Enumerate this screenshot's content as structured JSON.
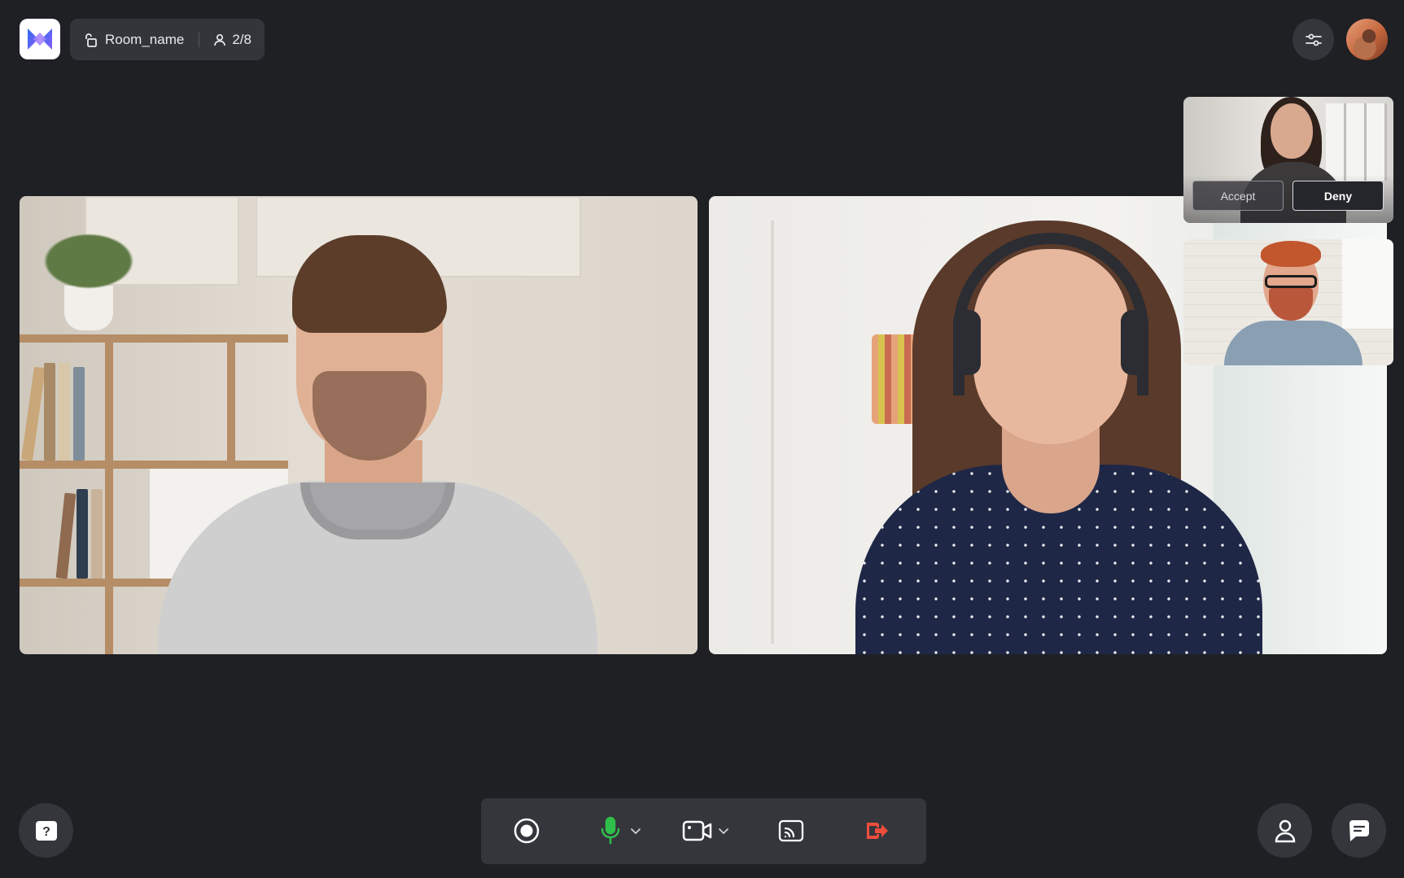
{
  "app": {
    "logo_icon": "app-logo-icon",
    "brand_colors": [
      "#3a6df0",
      "#7b5cf5"
    ]
  },
  "room": {
    "name": "Room_name",
    "participants": "2/8",
    "lock_icon": "unlock-icon",
    "person_icon": "person-icon"
  },
  "topbar": {
    "settings_icon": "sliders-icon",
    "avatar_icon": "user-avatar"
  },
  "main_tiles": [
    {
      "participant": "man-in-grey-sweater"
    },
    {
      "participant": "woman-with-headphones"
    }
  ],
  "join_request": {
    "accept_label": "Accept",
    "deny_label": "Deny"
  },
  "side_tiles": [
    {
      "participant": "woman-requesting-join"
    },
    {
      "participant": "man-with-glasses"
    }
  ],
  "controls": {
    "record_icon": "record-icon",
    "mic_icon": "microphone-icon",
    "mic_color": "#2fbf4a",
    "camera_icon": "camera-icon",
    "cast_icon": "screen-share-icon",
    "leave_icon": "leave-icon",
    "leave_color": "#ef4d3c",
    "help_icon": "help-icon",
    "participants_icon": "participants-icon",
    "chat_icon": "chat-icon"
  }
}
